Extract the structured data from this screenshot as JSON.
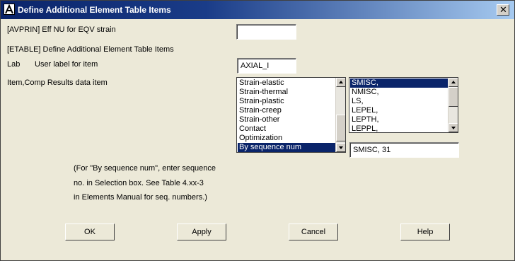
{
  "window": {
    "title": "Define Additional Element Table Items",
    "close_symbol": "✕"
  },
  "avprin": {
    "label": "[AVPRIN]  Eff NU for EQV strain",
    "value": ""
  },
  "etable": {
    "label": "[ETABLE]  Define Additional Element Table Items"
  },
  "lab": {
    "key": "Lab",
    "desc": "User label for item",
    "value": "AXIAL_I"
  },
  "itemcomp": {
    "label": "Item,Comp  Results data item",
    "left_list": {
      "items": [
        "Strain-elastic",
        "Strain-thermal",
        "Strain-plastic",
        "Strain-creep",
        "Strain-other",
        "Contact",
        "Optimization",
        "By sequence num"
      ],
      "selected_index": 7
    },
    "right_list": {
      "items": [
        "SMISC,",
        "NMISC,",
        "LS,",
        "LEPEL,",
        "LEPTH,",
        "LEPPL,"
      ],
      "selected_index": 0
    },
    "selection_value": "SMISC, 31"
  },
  "note": {
    "line1": "(For \"By sequence num\", enter sequence",
    "line2": "no. in Selection box.  See Table 4.xx-3",
    "line3": "in Elements Manual for seq. numbers.)"
  },
  "buttons": {
    "ok": "OK",
    "apply": "Apply",
    "cancel": "Cancel",
    "help": "Help"
  }
}
